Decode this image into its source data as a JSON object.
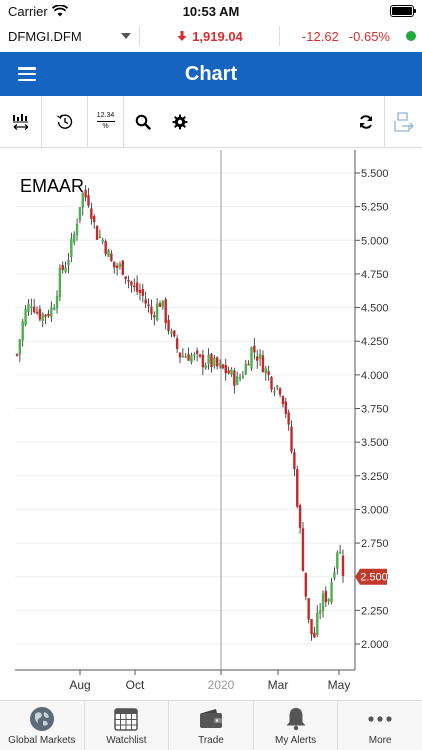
{
  "status_bar": {
    "carrier": "Carrier",
    "time": "10:53 AM"
  },
  "ticker": {
    "symbol": "DFMGI.DFM",
    "price": "1,919.04",
    "change": "-12.62",
    "change_pct": "-0.65%",
    "up_color": "#22a93b",
    "down_color": "#d32f2f"
  },
  "nav": {
    "title": "Chart",
    "bar_color": "#1565c0"
  },
  "toolbar": {
    "icons": [
      "interval-icon",
      "history-icon",
      "scale-icon",
      "search-icon",
      "settings-icon",
      "refresh-icon",
      "share-icon"
    ],
    "scale_text_top": "12.34",
    "scale_text_bottom": "%"
  },
  "chart_data": {
    "type": "candlestick",
    "title": "EMAAR",
    "x_ticks": [
      "Aug",
      "Oct",
      "2020",
      "Mar",
      "May"
    ],
    "y_ticks": [
      "5.500",
      "5.250",
      "5.000",
      "4.750",
      "4.500",
      "4.250",
      "4.000",
      "3.750",
      "3.500",
      "3.250",
      "3.000",
      "2.750",
      "2.500",
      "2.250",
      "2.000"
    ],
    "ylim": [
      1.9,
      5.55
    ],
    "last_price": "2.500",
    "last_price_value": 2.5,
    "approx_close_path": [
      [
        0,
        4.15
      ],
      [
        3,
        4.45
      ],
      [
        6,
        4.55
      ],
      [
        9,
        4.45
      ],
      [
        12,
        4.45
      ],
      [
        15,
        4.5
      ],
      [
        18,
        4.75
      ],
      [
        21,
        4.85
      ],
      [
        24,
        5.05
      ],
      [
        27,
        5.35
      ],
      [
        30,
        5.3
      ],
      [
        33,
        5.05
      ],
      [
        36,
        5.0
      ],
      [
        40,
        4.8
      ],
      [
        44,
        4.8
      ],
      [
        48,
        4.65
      ],
      [
        52,
        4.6
      ],
      [
        56,
        4.45
      ],
      [
        60,
        4.55
      ],
      [
        64,
        4.3
      ],
      [
        68,
        4.15
      ],
      [
        72,
        4.15
      ],
      [
        76,
        4.1
      ],
      [
        80,
        4.1
      ],
      [
        84,
        4.05
      ],
      [
        88,
        4.02
      ],
      [
        92,
        3.95
      ],
      [
        95,
        4.05
      ],
      [
        98,
        4.2
      ],
      [
        102,
        4.1
      ],
      [
        106,
        3.95
      ],
      [
        110,
        3.9
      ],
      [
        112,
        3.75
      ],
      [
        114,
        3.5
      ],
      [
        116,
        3.25
      ],
      [
        118,
        2.85
      ],
      [
        120,
        2.45
      ],
      [
        122,
        2.1
      ],
      [
        124,
        2.05
      ],
      [
        126,
        2.25
      ],
      [
        128,
        2.35
      ],
      [
        130,
        2.35
      ],
      [
        132,
        2.55
      ],
      [
        134,
        2.75
      ],
      [
        136,
        2.55
      ]
    ],
    "grid": "horizontal",
    "legend": "none"
  },
  "tabs": [
    {
      "label": "Global Markets",
      "icon": "globe-icon"
    },
    {
      "label": "Watchlist",
      "icon": "calendar-icon"
    },
    {
      "label": "Trade",
      "icon": "wallet-icon"
    },
    {
      "label": "My Alerts",
      "icon": "bell-icon"
    },
    {
      "label": "More",
      "icon": "more-icon"
    }
  ]
}
